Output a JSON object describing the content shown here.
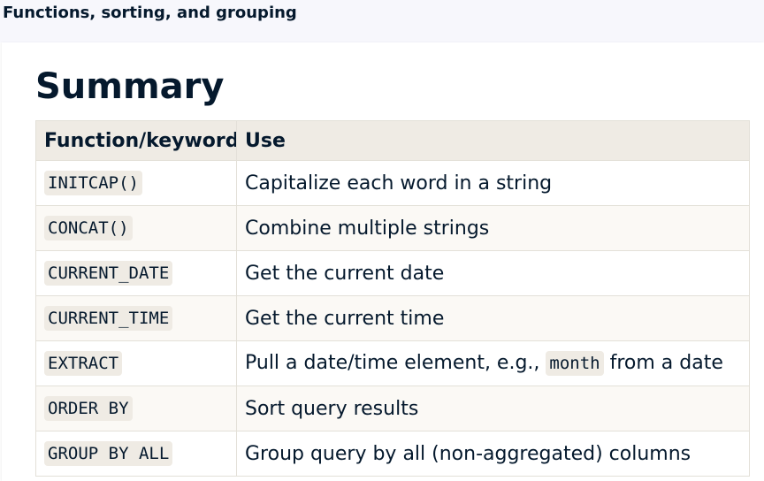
{
  "header": {
    "title": "Functions, sorting, and grouping"
  },
  "slide": {
    "heading": "Summary",
    "table": {
      "columns": [
        "Function/keyword",
        "Use"
      ],
      "rows": [
        {
          "keyword": "INITCAP()",
          "use": "Capitalize each word in a string"
        },
        {
          "keyword": "CONCAT()",
          "use": "Combine multiple strings"
        },
        {
          "keyword": "CURRENT_DATE",
          "use": "Get the current date"
        },
        {
          "keyword": "CURRENT_TIME",
          "use": "Get the current time"
        },
        {
          "keyword": "EXTRACT",
          "use_before": "Pull a date/time element, e.g., ",
          "use_code": "month",
          "use_after": " from a date"
        },
        {
          "keyword": "ORDER BY",
          "use": "Sort query results"
        },
        {
          "keyword": "GROUP BY ALL",
          "use": "Group query by all (non-aggregated) columns"
        }
      ]
    }
  },
  "colors": {
    "text": "#05192d",
    "header_bg": "#efebe4",
    "code_bg": "#efebe4",
    "alt_row_bg": "#fbf9f5",
    "topbar_bg": "#f7f7fc"
  }
}
